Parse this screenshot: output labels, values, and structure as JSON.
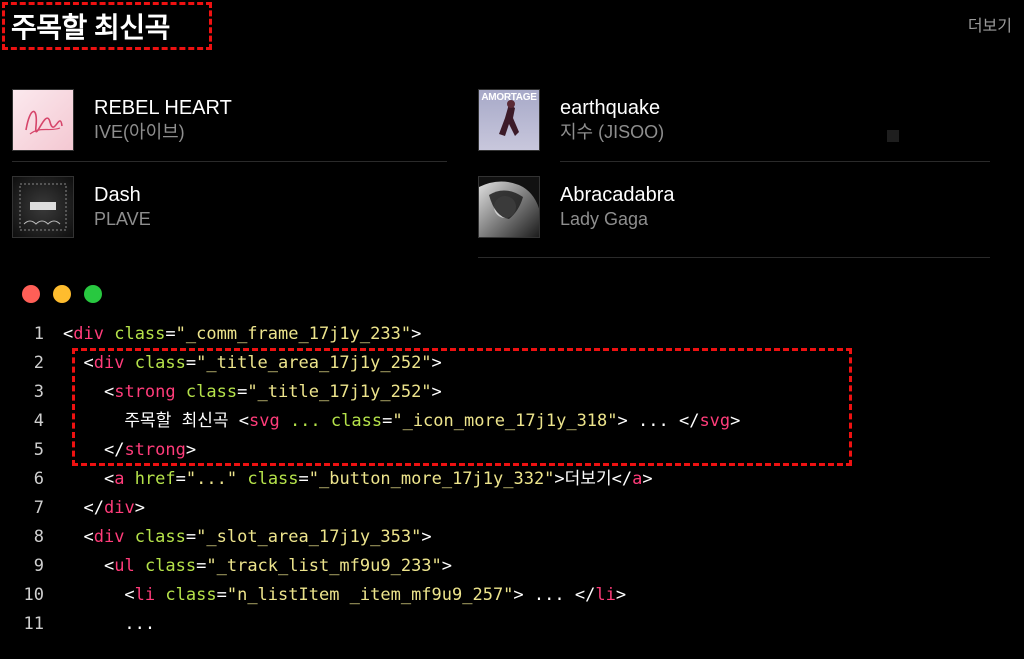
{
  "header": {
    "title": "주목할 최신곡",
    "more_label": "더보기"
  },
  "tracks": [
    {
      "name": "REBEL HEART",
      "artist": "IVE(아이브)",
      "cover": "ive-rebel-heart-cover"
    },
    {
      "name": "earthquake",
      "artist": "지수 (JISOO)",
      "cover": "amortage-cover",
      "cover_text": "AMORTAGE"
    },
    {
      "name": "Dash",
      "artist": "PLAVE",
      "cover": "plave-caligo-cover"
    },
    {
      "name": "Abracadabra",
      "artist": "Lady Gaga",
      "cover": "lady-gaga-abracadabra-cover"
    }
  ],
  "window_dots": {
    "red": "#ff5f57",
    "yellow": "#febc2e",
    "green": "#28c840"
  },
  "code_lines": [
    {
      "num": "1",
      "tokens": [
        [
          "p",
          "<"
        ],
        [
          "t",
          "div"
        ],
        [
          "x",
          " "
        ],
        [
          "a",
          "class"
        ],
        [
          "p",
          "="
        ],
        [
          "s",
          "\"_comm_frame_17j1y_233\""
        ],
        [
          "p",
          ">"
        ]
      ]
    },
    {
      "num": "2",
      "tokens": [
        [
          "x",
          "  "
        ],
        [
          "p",
          "<"
        ],
        [
          "t",
          "div"
        ],
        [
          "x",
          " "
        ],
        [
          "a",
          "class"
        ],
        [
          "p",
          "="
        ],
        [
          "s",
          "\"_title_area_17j1y_252\""
        ],
        [
          "p",
          ">"
        ]
      ]
    },
    {
      "num": "3",
      "tokens": [
        [
          "x",
          "    "
        ],
        [
          "p",
          "<"
        ],
        [
          "t",
          "strong"
        ],
        [
          "x",
          " "
        ],
        [
          "a",
          "class"
        ],
        [
          "p",
          "="
        ],
        [
          "s",
          "\"_title_17j1y_252\""
        ],
        [
          "p",
          ">"
        ]
      ]
    },
    {
      "num": "4",
      "tokens": [
        [
          "x",
          "      주목할 최신곡 "
        ],
        [
          "p",
          "<"
        ],
        [
          "t",
          "svg"
        ],
        [
          "x",
          " "
        ],
        [
          "a",
          "..."
        ],
        [
          "x",
          " "
        ],
        [
          "a",
          "class"
        ],
        [
          "p",
          "="
        ],
        [
          "s",
          "\"_icon_more_17j1y_318\""
        ],
        [
          "p",
          ">"
        ],
        [
          "x",
          " ... "
        ],
        [
          "p",
          "</"
        ],
        [
          "t",
          "svg"
        ],
        [
          "p",
          ">"
        ]
      ]
    },
    {
      "num": "5",
      "tokens": [
        [
          "x",
          "    "
        ],
        [
          "p",
          "</"
        ],
        [
          "t",
          "strong"
        ],
        [
          "p",
          ">"
        ]
      ]
    },
    {
      "num": "6",
      "tokens": [
        [
          "x",
          "    "
        ],
        [
          "p",
          "<"
        ],
        [
          "t",
          "a"
        ],
        [
          "x",
          " "
        ],
        [
          "a",
          "href"
        ],
        [
          "p",
          "="
        ],
        [
          "s",
          "\"...\""
        ],
        [
          "x",
          " "
        ],
        [
          "a",
          "class"
        ],
        [
          "p",
          "="
        ],
        [
          "s",
          "\"_button_more_17j1y_332\""
        ],
        [
          "p",
          ">"
        ],
        [
          "x",
          "더보기"
        ],
        [
          "p",
          "</"
        ],
        [
          "t",
          "a"
        ],
        [
          "p",
          ">"
        ]
      ]
    },
    {
      "num": "7",
      "tokens": [
        [
          "x",
          "  "
        ],
        [
          "p",
          "</"
        ],
        [
          "t",
          "div"
        ],
        [
          "p",
          ">"
        ]
      ]
    },
    {
      "num": "8",
      "tokens": [
        [
          "x",
          "  "
        ],
        [
          "p",
          "<"
        ],
        [
          "t",
          "div"
        ],
        [
          "x",
          " "
        ],
        [
          "a",
          "class"
        ],
        [
          "p",
          "="
        ],
        [
          "s",
          "\"_slot_area_17j1y_353\""
        ],
        [
          "p",
          ">"
        ]
      ]
    },
    {
      "num": "9",
      "tokens": [
        [
          "x",
          "    "
        ],
        [
          "p",
          "<"
        ],
        [
          "t",
          "ul"
        ],
        [
          "x",
          " "
        ],
        [
          "a",
          "class"
        ],
        [
          "p",
          "="
        ],
        [
          "s",
          "\"_track_list_mf9u9_233\""
        ],
        [
          "p",
          ">"
        ]
      ]
    },
    {
      "num": "10",
      "tokens": [
        [
          "x",
          "      "
        ],
        [
          "p",
          "<"
        ],
        [
          "t",
          "li"
        ],
        [
          "x",
          " "
        ],
        [
          "a",
          "class"
        ],
        [
          "p",
          "="
        ],
        [
          "s",
          "\"n_listItem _item_mf9u9_257\""
        ],
        [
          "p",
          ">"
        ],
        [
          "x",
          " ... "
        ],
        [
          "p",
          "</"
        ],
        [
          "t",
          "li"
        ],
        [
          "p",
          ">"
        ]
      ]
    },
    {
      "num": "11",
      "tokens": [
        [
          "x",
          "      ..."
        ]
      ]
    }
  ]
}
